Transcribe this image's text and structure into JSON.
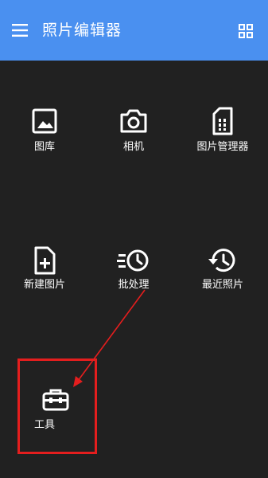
{
  "header": {
    "title": "照片编辑器"
  },
  "tiles": [
    {
      "label": "图库"
    },
    {
      "label": "相机"
    },
    {
      "label": "图片管理器"
    },
    {
      "label": "新建图片"
    },
    {
      "label": "批处理"
    },
    {
      "label": "最近照片"
    },
    {
      "label": "工具"
    }
  ],
  "colors": {
    "header": "#4a90f0",
    "background": "#212121",
    "annotation": "#e41e1e"
  }
}
